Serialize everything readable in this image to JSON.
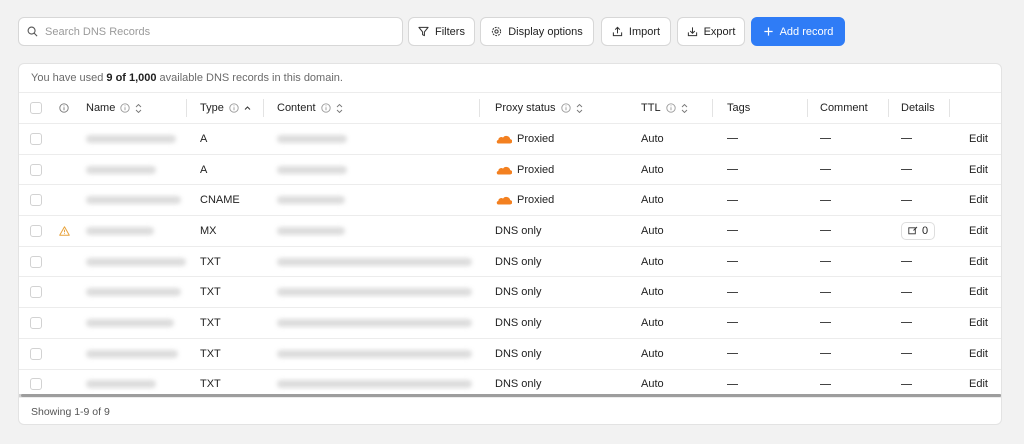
{
  "toolbar": {
    "search_placeholder": "Search DNS Records",
    "filters_label": "Filters",
    "display_options_label": "Display options",
    "import_label": "Import",
    "export_label": "Export",
    "add_record_label": "Add record"
  },
  "usage": {
    "prefix": "You have used",
    "used": "9 of 1,000",
    "suffix": "available DNS records in this domain."
  },
  "columns": {
    "name": "Name",
    "type": "Type",
    "content": "Content",
    "proxy_status": "Proxy status",
    "ttl": "TTL",
    "tags": "Tags",
    "comment": "Comment",
    "details": "Details"
  },
  "rows": [
    {
      "type": "A",
      "proxy": "Proxied",
      "proxied": true,
      "ttl": "Auto",
      "warning": false,
      "details": "",
      "edit": "Edit"
    },
    {
      "type": "A",
      "proxy": "Proxied",
      "proxied": true,
      "ttl": "Auto",
      "warning": false,
      "details": "",
      "edit": "Edit"
    },
    {
      "type": "CNAME",
      "proxy": "Proxied",
      "proxied": true,
      "ttl": "Auto",
      "warning": false,
      "details": "",
      "edit": "Edit"
    },
    {
      "type": "MX",
      "proxy": "DNS only",
      "proxied": false,
      "ttl": "Auto",
      "warning": true,
      "details": "0",
      "edit": "Edit"
    },
    {
      "type": "TXT",
      "proxy": "DNS only",
      "proxied": false,
      "ttl": "Auto",
      "warning": false,
      "details": "",
      "edit": "Edit"
    },
    {
      "type": "TXT",
      "proxy": "DNS only",
      "proxied": false,
      "ttl": "Auto",
      "warning": false,
      "details": "",
      "edit": "Edit"
    },
    {
      "type": "TXT",
      "proxy": "DNS only",
      "proxied": false,
      "ttl": "Auto",
      "warning": false,
      "details": "",
      "edit": "Edit"
    },
    {
      "type": "TXT",
      "proxy": "DNS only",
      "proxied": false,
      "ttl": "Auto",
      "warning": false,
      "details": "",
      "edit": "Edit"
    },
    {
      "type": "TXT",
      "proxy": "DNS only",
      "proxied": false,
      "ttl": "Auto",
      "warning": false,
      "details": "",
      "edit": "Edit"
    }
  ],
  "footer": {
    "showing": "Showing 1-9 of 9"
  },
  "colors": {
    "accent": "#2f7cf6",
    "proxied_cloud": "#f38020",
    "warning": "#e8a33d"
  }
}
